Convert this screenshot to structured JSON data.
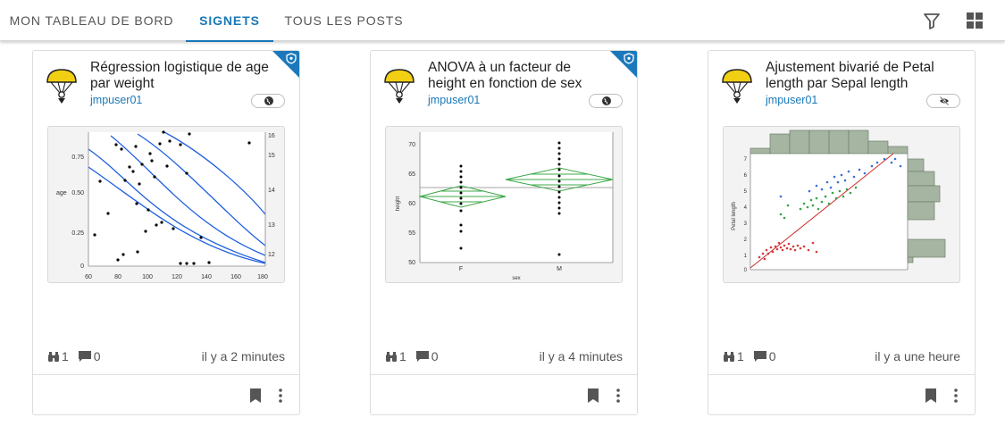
{
  "tabs": [
    {
      "label": "MON TABLEAU DE BORD",
      "active": false
    },
    {
      "label": "SIGNETS",
      "active": true
    },
    {
      "label": "TOUS LES POSTS",
      "active": false
    }
  ],
  "toolbar": {
    "filter_icon": "filter-icon",
    "grid_icon": "grid-view-icon"
  },
  "colors": {
    "accent": "#1a78b8",
    "ribbon": "#1b79bb",
    "text_muted": "#555555"
  },
  "cards": [
    {
      "title": "Régression logistique de age par weight",
      "author": "jmpuser01",
      "visibility_icon": "globe-icon",
      "bookmarked_badge": true,
      "views": "1",
      "comments": "0",
      "time": "il y a 2 minutes",
      "chart": {
        "ylabel": "age",
        "y_ticks": [
          "0",
          "0.25",
          "0.50",
          "0.75"
        ],
        "x_ticks": [
          "60",
          "80",
          "100",
          "120",
          "140",
          "160",
          "180"
        ],
        "y2_ticks": [
          "12",
          "13",
          "14",
          "15",
          "16"
        ]
      }
    },
    {
      "title": "ANOVA à un facteur de height en fonction de sex",
      "author": "jmpuser01",
      "visibility_icon": "globe-icon",
      "bookmarked_badge": true,
      "views": "1",
      "comments": "0",
      "time": "il y a 4 minutes",
      "chart": {
        "ylabel": "height",
        "xlabel": "sex",
        "y_ticks": [
          "50",
          "55",
          "60",
          "65",
          "70"
        ],
        "x_ticks": [
          "F",
          "M"
        ]
      }
    },
    {
      "title": "Ajustement bivarié de Petal length par Sepal length",
      "author": "jmpuser01",
      "visibility_icon": "eye-off-icon",
      "bookmarked_badge": false,
      "views": "1",
      "comments": "0",
      "time": "il y a une heure",
      "chart": {
        "ylabel": "Petal length",
        "y_ticks": [
          "0",
          "1",
          "2",
          "3",
          "4",
          "5",
          "6",
          "7"
        ]
      }
    }
  ]
}
